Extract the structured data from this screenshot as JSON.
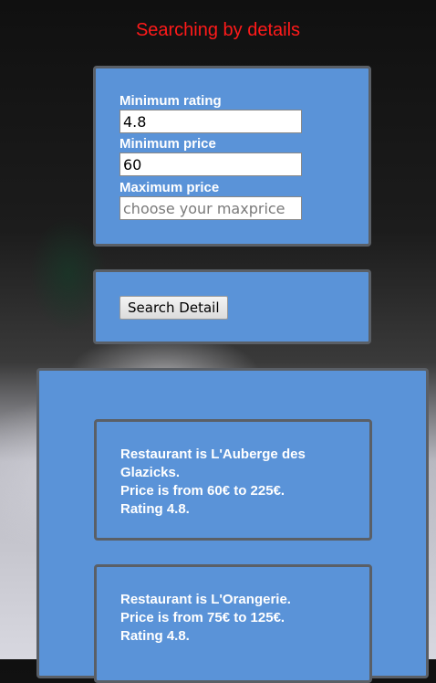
{
  "page": {
    "title": "Searching by details"
  },
  "filters": {
    "min_rating": {
      "label": "Minimum rating",
      "value": "4.8",
      "placeholder": ""
    },
    "min_price": {
      "label": "Minimum price",
      "value": "60",
      "placeholder": ""
    },
    "max_price": {
      "label": "Maximum price",
      "value": "",
      "placeholder": "choose your maxprice"
    }
  },
  "search": {
    "button_label": "Search Detail"
  },
  "results": [
    {
      "restaurant": "Restaurant is L'Auberge des Glazicks.",
      "price": "Price is from 60€ to 225€.",
      "rating": "Rating 4.8."
    },
    {
      "restaurant": "Restaurant is L'Orangerie.",
      "price": "Price is from 75€ to 125€.",
      "rating": "Rating 4.8."
    }
  ]
}
